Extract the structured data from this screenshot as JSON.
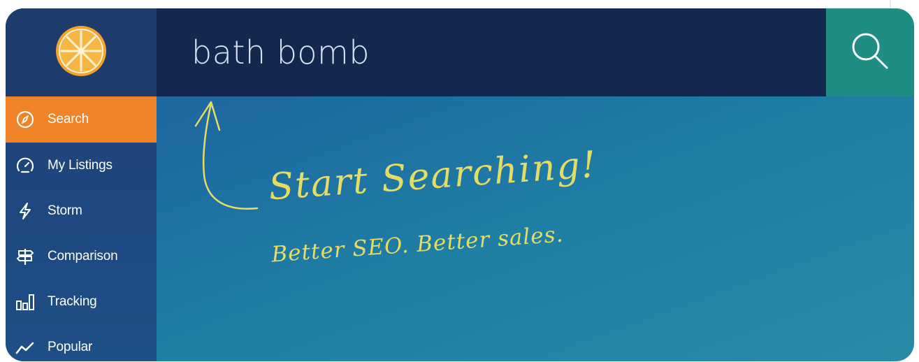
{
  "app": {
    "logo_icon": "orange-slice-icon",
    "colors": {
      "accent_orange": "#f08327",
      "search_bar": "#14284f",
      "search_button": "#1e8d82",
      "handwriting": "#e6dc63"
    }
  },
  "search": {
    "value": "bath bomb",
    "button_icon": "search-icon"
  },
  "sidebar": {
    "items": [
      {
        "label": "Search",
        "icon": "compass-icon",
        "active": true
      },
      {
        "label": "My Listings",
        "icon": "speedometer-icon",
        "active": false
      },
      {
        "label": "Storm",
        "icon": "lightning-icon",
        "active": false
      },
      {
        "label": "Comparison",
        "icon": "signpost-icon",
        "active": false
      },
      {
        "label": "Tracking",
        "icon": "bar-chart-icon",
        "active": false
      },
      {
        "label": "Popular",
        "icon": "trend-line-icon",
        "active": false
      }
    ]
  },
  "hero": {
    "title": "Start Searching!",
    "subtitle": "Better SEO. Better sales."
  }
}
